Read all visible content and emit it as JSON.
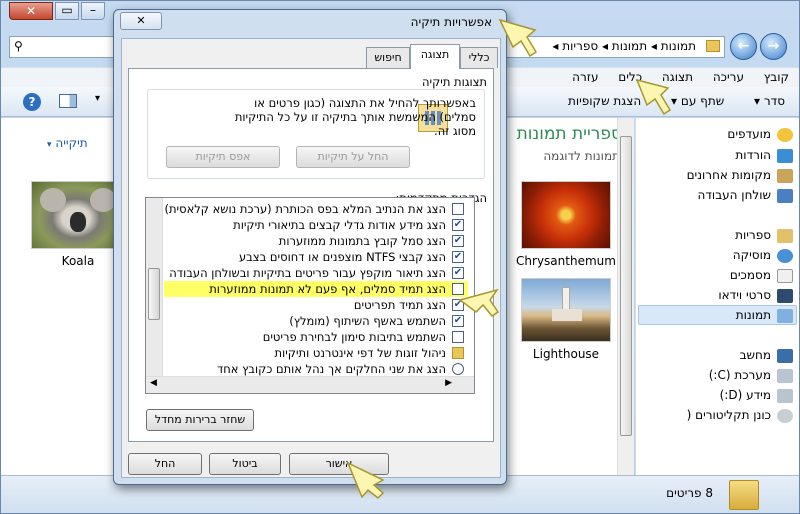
{
  "explorer": {
    "breadcrumb": "תמונות ◂ תמונות ◂ ספריות ◂",
    "menu": [
      "קובץ",
      "עריכה",
      "תצוגה",
      "כלים",
      "עזרה"
    ],
    "toolbar": [
      "סדר ▾",
      "שתף עם ▾",
      "הצגת שקופיות"
    ],
    "library_title": "ספריית תמונות",
    "library_sub": "תמונות לדוגמה",
    "arrange_label": "תיקייה",
    "nav": {
      "favorites": "מועדפים",
      "downloads": "הורדות",
      "recent": "מקומות אחרונים",
      "desktop": "שולחן העבודה",
      "libraries": "ספריות",
      "music": "מוסיקה",
      "documents": "מסמכים",
      "videos": "סרטי וידאו",
      "pictures": "תמונות",
      "computer": "מחשב",
      "c_drive": "מערכת (C:)",
      "d_drive": "מידע (D:)",
      "directories": "כונן תקליטורים ("
    },
    "thumbs": [
      "Koala",
      "Chrysanthemum",
      "Lighthouse"
    ],
    "status": "8 פריטים"
  },
  "dialog": {
    "title": "אפשרויות תיקיה",
    "close": "✕",
    "tabs": [
      "כללי",
      "תצוגה",
      "חיפוש"
    ],
    "folder_views_header": "תצוגות תיקיה",
    "folder_views_text": "באפשרותך להחיל את התצוגה (כגון פרטים או סמלים) המשמשת אותך בתיקיה זו על כל התיקיות מסוג זה.",
    "apply_button": "החל על תיקיות",
    "reset_button": "אפס תיקיות",
    "advanced_header": "הגדרות מתקדמות:",
    "advanced_items": [
      {
        "label": "הצג את הנתיב המלא בפס הכותרת (ערכת נושא קלאסית)",
        "checked": false
      },
      {
        "label": "הצג מידע אודות גדלי קבצים בתיאורי תיקיות",
        "checked": true
      },
      {
        "label": "הצג סמל קובץ בתמונות ממוזערות",
        "checked": true
      },
      {
        "label": "הצג קבצי NTFS מוצפנים או דחוסים בצבע",
        "checked": true
      },
      {
        "label": "הצג תיאור מוקפץ עבור פריטים בתיקיות ובשולחן העבודה",
        "checked": true
      },
      {
        "label": "הצג תמיד סמלים, אף פעם לא תמונות ממוזערות",
        "checked": false
      },
      {
        "label": "הצג תמיד תפריטים",
        "checked": true
      },
      {
        "label": "השתמש באשף השיתוף (מומלץ)",
        "checked": true
      },
      {
        "label": "השתמש בתיבות סימון לבחירת פריטים",
        "checked": false
      },
      {
        "label": "ניהול זוגות של דפי אינטרנט ותיקיות",
        "checked": false
      },
      {
        "label": "הצג את שני החלקים אך נהל אותם כקובץ אחד",
        "checked": false
      }
    ],
    "restore_button": "שחזר ברירות מחדל",
    "ok": "אישור",
    "cancel": "ביטול",
    "apply": "החל"
  },
  "colors": {
    "highlight": "#ffff66",
    "title_green": "#2e8b57"
  }
}
